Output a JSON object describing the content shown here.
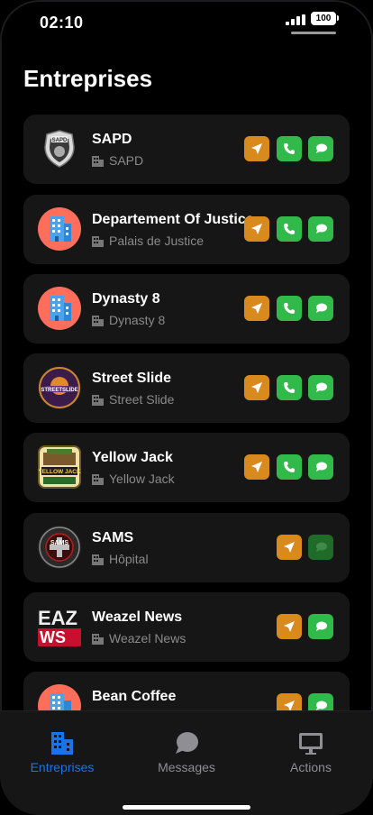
{
  "status": {
    "time": "02:10",
    "battery": "100"
  },
  "page_title": "Entreprises",
  "companies": [
    {
      "name": "SAPD",
      "location": "SAPD",
      "logo_icon": "sapd-badge-icon",
      "actions": [
        "nav",
        "call",
        "msg"
      ]
    },
    {
      "name": "Departement Of Justice",
      "location": "Palais de Justice",
      "logo_icon": "building-icon",
      "actions": [
        "nav",
        "call",
        "msg"
      ]
    },
    {
      "name": "Dynasty 8",
      "location": "Dynasty 8",
      "logo_icon": "building-icon",
      "actions": [
        "nav",
        "call",
        "msg"
      ]
    },
    {
      "name": "Street Slide",
      "location": "Street Slide",
      "logo_icon": "street-slide-logo-icon",
      "logo_text": "STREETSLIDE",
      "actions": [
        "nav",
        "call",
        "msg"
      ]
    },
    {
      "name": "Yellow Jack",
      "location": "Yellow Jack",
      "logo_icon": "yellow-jack-logo-icon",
      "logo_text": "YELLOW JACK",
      "actions": [
        "nav",
        "call",
        "msg"
      ]
    },
    {
      "name": "SAMS",
      "location": "Hôpital",
      "logo_icon": "sams-logo-icon",
      "logo_text": "SAMS",
      "actions": [
        "nav",
        "msg-dim"
      ]
    },
    {
      "name": "Weazel News",
      "location": "Weazel News",
      "logo_icon": "weazel-news-logo-icon",
      "logo_text": "EAZ WS",
      "actions": [
        "nav",
        "msg"
      ]
    },
    {
      "name": "Bean Coffee",
      "location": "",
      "logo_icon": "building-icon",
      "actions": [
        "nav",
        "msg"
      ]
    }
  ],
  "tabs": [
    {
      "label": "Entreprises",
      "icon": "buildings-icon",
      "active": true
    },
    {
      "label": "Messages",
      "icon": "chat-bubble-icon",
      "active": false
    },
    {
      "label": "Actions",
      "icon": "monitor-icon",
      "active": false
    }
  ],
  "colors": {
    "nav": "#d98a1c",
    "call": "#31b94a",
    "msg": "#31b94a",
    "active_tab": "#1a73e8",
    "building_bg": "#ff6e5a"
  }
}
